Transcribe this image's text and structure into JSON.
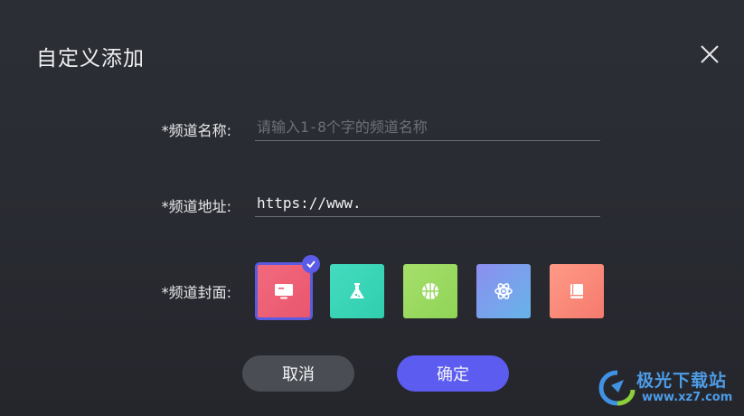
{
  "dialog": {
    "title": "自定义添加"
  },
  "form": {
    "name_label": "*频道名称:",
    "name_placeholder": "请输入1-8个字的频道名称",
    "name_value": "",
    "url_label": "*频道地址:",
    "url_value": "https://www.",
    "cover_label": "*频道封面:",
    "covers": [
      {
        "icon": "monitor-icon",
        "color_start": "#f26a7e",
        "color_end": "#e8566e",
        "selected": true
      },
      {
        "icon": "flask-icon",
        "color_start": "#45dbc0",
        "color_end": "#2fcfae",
        "selected": false
      },
      {
        "icon": "basketball-icon",
        "color_start": "#a6df6b",
        "color_end": "#8fd457",
        "selected": false
      },
      {
        "icon": "atom-icon",
        "color_start": "#8d8ef0",
        "color_end": "#66b4e8",
        "selected": false
      },
      {
        "icon": "book-icon",
        "color_start": "#ff9a86",
        "color_end": "#f57a6e",
        "selected": false
      }
    ]
  },
  "buttons": {
    "cancel": "取消",
    "ok": "确定"
  },
  "watermark": {
    "name": "极光下载站",
    "url": "www.xz7.com"
  },
  "colors": {
    "accent": "#5c5cf0",
    "background": "#2a2c33"
  }
}
